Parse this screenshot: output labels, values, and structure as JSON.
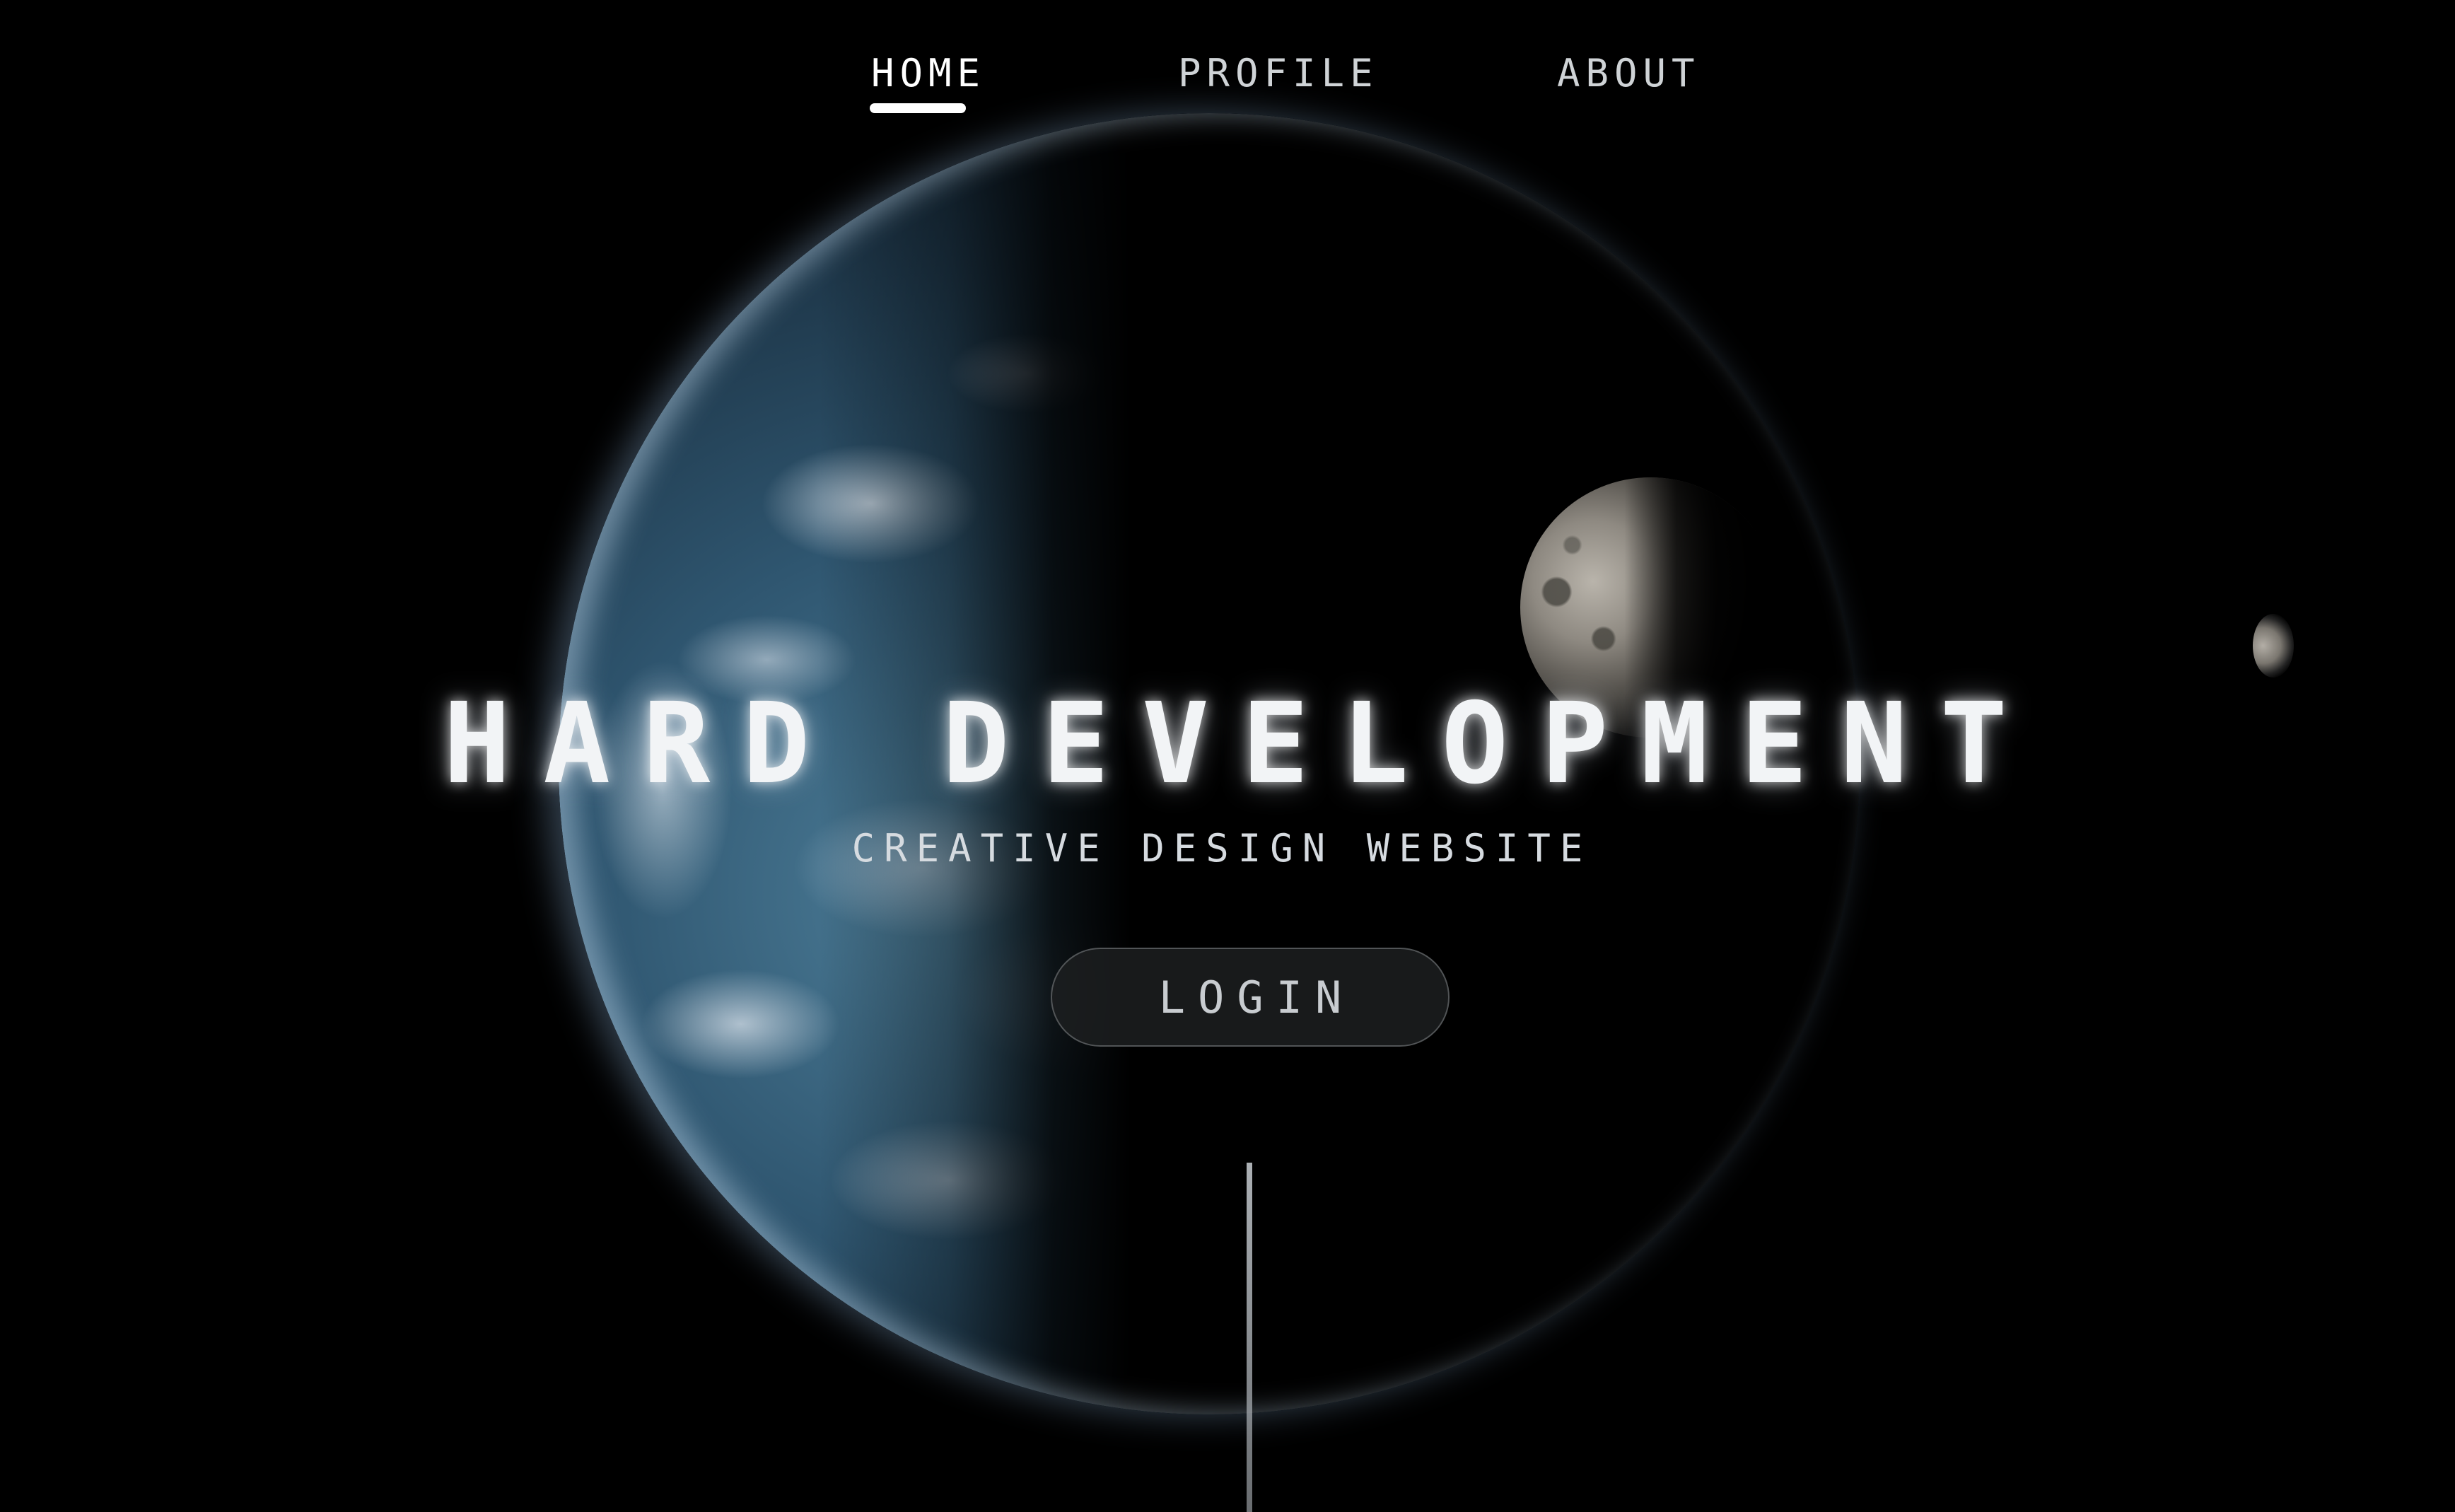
{
  "nav": {
    "items": [
      {
        "label": "HOME",
        "active": true
      },
      {
        "label": "PROFILE",
        "active": false
      },
      {
        "label": "ABOUT",
        "active": false
      }
    ]
  },
  "hero": {
    "title": "HARD DEVELOPMENT",
    "subtitle": "CREATIVE DESIGN WEBSITE",
    "login_label": "LOGIN"
  },
  "colors": {
    "background": "#000000",
    "text": "#f2f4f6",
    "active_underline": "#ffffff"
  },
  "icons": {
    "planet": "earth-planet-icon",
    "moon": "moon-icon",
    "small_moon": "small-moon-icon"
  }
}
